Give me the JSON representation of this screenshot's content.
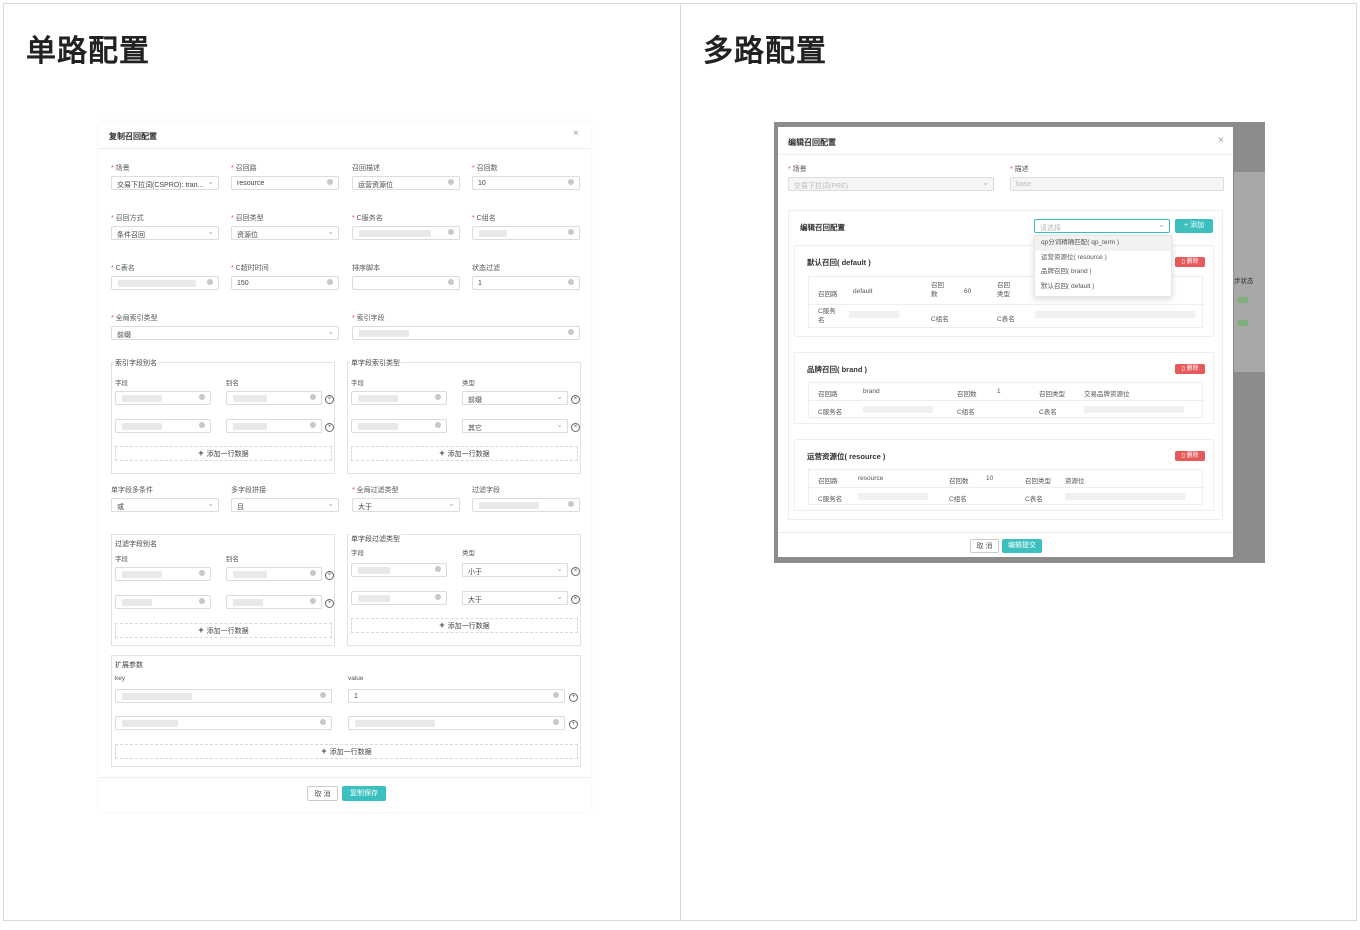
{
  "left_panel": {
    "title": "单路配置",
    "modal": {
      "title": "复制召回配置",
      "row1": {
        "scene_label": "场景",
        "scene_value": "交易下拉词(CSPRO): tran...",
        "recall_label": "召回路",
        "recall_value": "resource",
        "desc_label": "召回描述",
        "desc_value": "运营资源位",
        "count_label": "召回数",
        "count_value": "10"
      },
      "row2": {
        "method_label": "召回方式",
        "method_value": "条件召回",
        "type_label": "召回类型",
        "type_value": "资源位",
        "service_label": "C服务名",
        "group_label": "C组名"
      },
      "row3": {
        "table_label": "C表名",
        "timeout_label": "C超时时间",
        "timeout_value": "150",
        "sort_label": "排序脚本",
        "status_label": "状态过滤",
        "status_value": "1"
      },
      "row4": {
        "global_index_label": "全局索引类型",
        "global_index_value": "前缀",
        "index_field_label": "索引字段"
      },
      "index_alias": {
        "title": "索引字段别名",
        "field_col": "字段",
        "alias_col": "别名",
        "add": "添加一行数据"
      },
      "single_index": {
        "title": "单字段索引类型",
        "field_col": "字段",
        "type_col": "类型",
        "row1_type": "前缀",
        "row2_type": "其它",
        "add": "添加一行数据"
      },
      "row5": {
        "cond_label": "单字段多条件",
        "cond_value": "或",
        "concat_label": "多字段拼接",
        "concat_value": "且",
        "filter_type_label": "全局过滤类型",
        "filter_type_value": "大于",
        "filter_field_label": "过滤字段"
      },
      "filter_alias": {
        "title": "过滤字段别名",
        "field_col": "字段",
        "alias_col": "别名",
        "add": "添加一行数据"
      },
      "single_filter": {
        "title": "单字段过滤类型",
        "field_col": "字段",
        "type_col": "类型",
        "row1_type": "小于",
        "row2_type": "大于",
        "add": "添加一行数据"
      },
      "ext": {
        "title": "扩展参数",
        "key_col": "key",
        "value_col": "value",
        "row1_value": "1",
        "add": "添加一行数据"
      },
      "cancel": "取 消",
      "save": "复制保存"
    }
  },
  "right_panel": {
    "title": "多路配置",
    "modal": {
      "title": "编辑召回配置",
      "scene_label": "场景",
      "scene_value": "交易下拉词(PRE)",
      "desc_label": "描述",
      "desc_value": "base",
      "edit_title": "编辑召回配置",
      "select_placeholder": "请选择",
      "add_btn": "添加",
      "dropdown": [
        "qp分词精确匹配( qp_term )",
        "运营资源位( resource )",
        "品牌召回( brand )",
        "默认召回( default )"
      ],
      "sections": [
        {
          "title": "默认召回( default )",
          "del": "删除",
          "recall_label": "召回路",
          "recall_value": "default",
          "count_label": "召回数",
          "count_value": "60",
          "type_label": "召回类型",
          "service_label": "C服务名",
          "group_label": "C组名",
          "table_label": "C表名"
        },
        {
          "title": "品牌召回( brand )",
          "del": "删除",
          "recall_label": "召回路",
          "recall_value": "brand",
          "count_label": "召回数",
          "count_value": "1",
          "type_label": "召回类型",
          "type_value": "交易品牌资源位",
          "service_label": "C服务名",
          "group_label": "C组名",
          "table_label": "C表名"
        },
        {
          "title": "运营资源位( resource )",
          "del": "删除",
          "recall_label": "召回路",
          "recall_value": "resource",
          "count_label": "召回数",
          "count_value": "10",
          "type_label": "召回类型",
          "type_value": "资源位",
          "service_label": "C服务名",
          "group_label": "C组名",
          "table_label": "C表名"
        }
      ],
      "bg_text": "步状态",
      "cancel": "取 消",
      "submit": "编辑提交"
    }
  },
  "colors": {
    "accent": "#3cbfbf",
    "danger": "#e85a5a",
    "required": "#e54d42"
  }
}
